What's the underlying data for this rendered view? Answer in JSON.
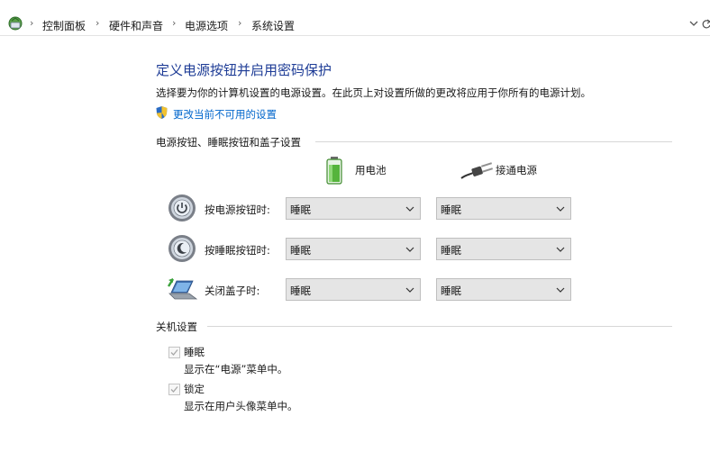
{
  "breadcrumb": {
    "items": [
      "控制面板",
      "硬件和声音",
      "电源选项",
      "系统设置"
    ]
  },
  "page": {
    "title": "定义电源按钮并启用密码保护",
    "description": "选择要为你的计算机设置的电源设置。在此页上对设置所做的更改将应用于你所有的电源计划。",
    "change_link": "更改当前不可用的设置"
  },
  "power_section": {
    "heading": "电源按钮、睡眠按钮和盖子设置",
    "columns": {
      "battery": "用电池",
      "plugged_in": "接通电源"
    },
    "rows": [
      {
        "label": "按电源按钮时:",
        "battery": "睡眠",
        "plugged_in": "睡眠"
      },
      {
        "label": "按睡眠按钮时:",
        "battery": "睡眠",
        "plugged_in": "睡眠"
      },
      {
        "label": "关闭盖子时:",
        "battery": "睡眠",
        "plugged_in": "睡眠"
      }
    ]
  },
  "shutdown_section": {
    "heading": "关机设置",
    "options": [
      {
        "label": "睡眠",
        "description": "显示在“电源”菜单中。",
        "checked": true
      },
      {
        "label": "锁定",
        "description": "显示在用户头像菜单中。",
        "checked": true
      }
    ]
  },
  "colors": {
    "title": "#1e3c96",
    "link": "#0066cc",
    "select_bg": "#e5e5e5"
  }
}
